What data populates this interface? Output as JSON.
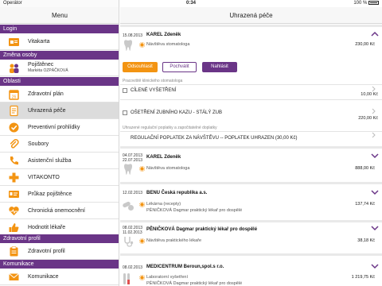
{
  "status_bar": {
    "carrier": "Operátor",
    "time": "0:34",
    "battery": "100 %"
  },
  "sidebar": {
    "title": "Menu",
    "sections": {
      "login": "Login",
      "person": "Změna osoby",
      "areas": "Oblasti",
      "profile": "Zdravotní profil",
      "communication": "Komunikace"
    },
    "items": {
      "vitakarta": "Vitakarta",
      "pojistenec": "Pojištěnec",
      "pojistenec_name": "Markéta OZPÁČKOVÁ",
      "zdravotni_plan": "Zdravotní plán",
      "uhrazena_pece": "Uhrazená péče",
      "preventivni": "Preventivní prohlídky",
      "soubory": "Soubory",
      "asistencni": "Asistenční služba",
      "vitakonto": "VITAKONTO",
      "prukaz": "Průkaz pojištěnce",
      "chronicka": "Chronická onemocnění",
      "hodnotit": "Hodnotit lékaře",
      "zdravotni_profil": "Zdravotní profil",
      "komunikace": "Komunikace"
    }
  },
  "main": {
    "title": "Uhrazená péče",
    "cards": [
      {
        "date": "15.08.2013",
        "name": "KAREL Zdeněk",
        "specialty": "Návštěva stomatologa",
        "amount": "230,00 Kč",
        "buttons": {
          "reject": "Odsouhlasit",
          "praise": "Pochválit",
          "report": "Nahlásit"
        },
        "section1_label": "Pracoviště klinického stomatologa",
        "line1": "CÍLENÉ VYŠETŘENÍ",
        "line1_price": "10,00 Kč",
        "line2": "OŠETŘENÍ ZUBNÍHO KAZU - STÁLÝ ZUB",
        "line2_price": "220,00 Kč",
        "section2_label": "Uhrazené regulační poplatky a započitatelné doplatky",
        "line3": "REGULAČNÍ POPLATEK ZA NÁVŠTĚVU -- POPLATEK UHRAZEN  (30,00 Kč)"
      },
      {
        "date": "04.07.2013",
        "date2": "22.07.2013",
        "name": "KAREL Zdeněk",
        "specialty": "Návštěva stomatologa",
        "amount": "888,00 Kč"
      },
      {
        "date": "12.02.2013",
        "name": "BENU Česká republika a.s.",
        "specialty": "Lékárna (recepty)",
        "doctor": "PĚNIČKOVÁ Dagmar praktický lékař pro dospělé",
        "amount": "137,74 Kč"
      },
      {
        "date": "08.02.2013",
        "date2": "11.02.2013",
        "name": "PĚNIČKOVÁ Dagmar praktický lékař pro dospělé",
        "specialty": "Návštěva praktického lékaře",
        "amount": "38,18 Kč"
      },
      {
        "date": "08.02.2013",
        "name": "MEDICENTRUM Beroun,spol.s r.o.",
        "specialty": "Laboratorní vyšetření",
        "doctor": "PĚNIČKOVÁ Dagmar praktický lékař pro dospělé",
        "amount": "1 219,75 Kč"
      }
    ]
  },
  "colors": {
    "accent": "#6a3587",
    "orange": "#f39412"
  }
}
